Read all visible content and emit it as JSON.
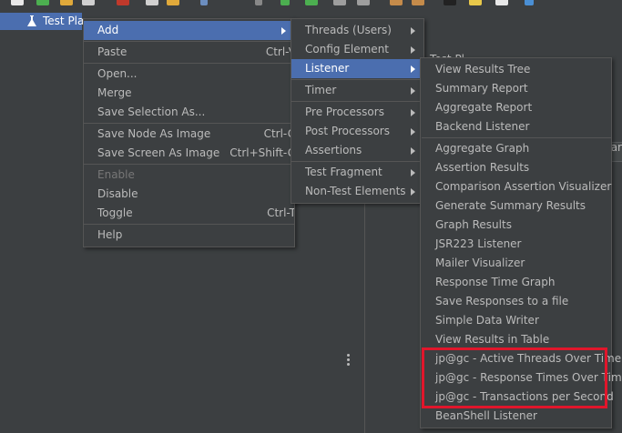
{
  "tree": {
    "selected_item": "Test Plan"
  },
  "right_panel": {
    "fragment_top": "Test Pl",
    "fragment_mid": "ar"
  },
  "context_menu": {
    "groups": [
      [
        {
          "label": "Add",
          "shortcut": "",
          "submenu": true,
          "selected": true
        }
      ],
      [
        {
          "label": "Paste",
          "shortcut": "Ctrl-V"
        }
      ],
      [
        {
          "label": "Open..."
        },
        {
          "label": "Merge"
        },
        {
          "label": "Save Selection As..."
        }
      ],
      [
        {
          "label": "Save Node As Image",
          "shortcut": "Ctrl-G"
        },
        {
          "label": "Save Screen As Image",
          "shortcut": "Ctrl+Shift-G"
        }
      ],
      [
        {
          "label": "Enable",
          "disabled": true
        },
        {
          "label": "Disable"
        },
        {
          "label": "Toggle",
          "shortcut": "Ctrl-T"
        }
      ],
      [
        {
          "label": "Help"
        }
      ]
    ]
  },
  "add_submenu": {
    "groups": [
      [
        {
          "label": "Threads (Users)"
        },
        {
          "label": "Config Element"
        },
        {
          "label": "Listener",
          "selected": true
        }
      ],
      [
        {
          "label": "Timer"
        }
      ],
      [
        {
          "label": "Pre Processors"
        },
        {
          "label": "Post Processors"
        },
        {
          "label": "Assertions"
        }
      ],
      [
        {
          "label": "Test Fragment"
        },
        {
          "label": "Non-Test Elements"
        }
      ]
    ]
  },
  "listener_submenu": {
    "groups": [
      [
        "View Results Tree",
        "Summary Report",
        "Aggregate Report",
        "Backend Listener"
      ],
      [
        "Aggregate Graph",
        "Assertion Results",
        "Comparison Assertion Visualizer",
        "Generate Summary Results",
        "Graph Results",
        "JSR223 Listener",
        "Mailer Visualizer",
        "Response Time Graph",
        "Save Responses to a file",
        "Simple Data Writer",
        "View Results in Table",
        "jp@gc - Active Threads Over Time",
        "jp@gc - Response Times Over Time",
        "jp@gc - Transactions per Second",
        "BeanShell Listener"
      ]
    ]
  },
  "highlight": {
    "color": "#e0162b"
  },
  "colors": {
    "background": "#3c3f41",
    "selection": "#4b6eaf",
    "text": "#bbbbbb",
    "separator": "#555555"
  }
}
